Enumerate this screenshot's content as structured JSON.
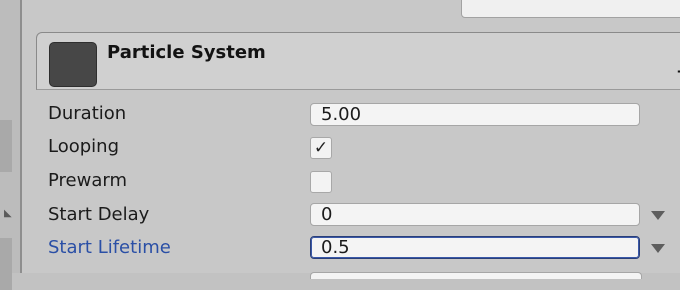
{
  "module": {
    "title": "Particle System",
    "add_label": "+"
  },
  "properties": [
    {
      "label": "Duration",
      "value": "5.00",
      "type": "float"
    },
    {
      "label": "Looping",
      "checked": true,
      "check_glyph": "✓",
      "type": "bool"
    },
    {
      "label": "Prewarm",
      "checked": false,
      "type": "bool"
    },
    {
      "label": "Start Delay",
      "value": "0",
      "type": "float-curve"
    },
    {
      "label": "Start Lifetime",
      "value": "0.5",
      "type": "float-curve",
      "focused": true
    }
  ],
  "colors": {
    "panel": "#c8c8c8",
    "field": "#f4f4f4",
    "active_label": "#2a4fa6",
    "focus_border": "#2a3f78"
  },
  "icons": {
    "module": "particle-system-icon",
    "add": "plus-icon",
    "dropdown": "triangle-down-icon",
    "checkmark": "checkmark-icon",
    "collapse": "chevron-left-icon"
  }
}
